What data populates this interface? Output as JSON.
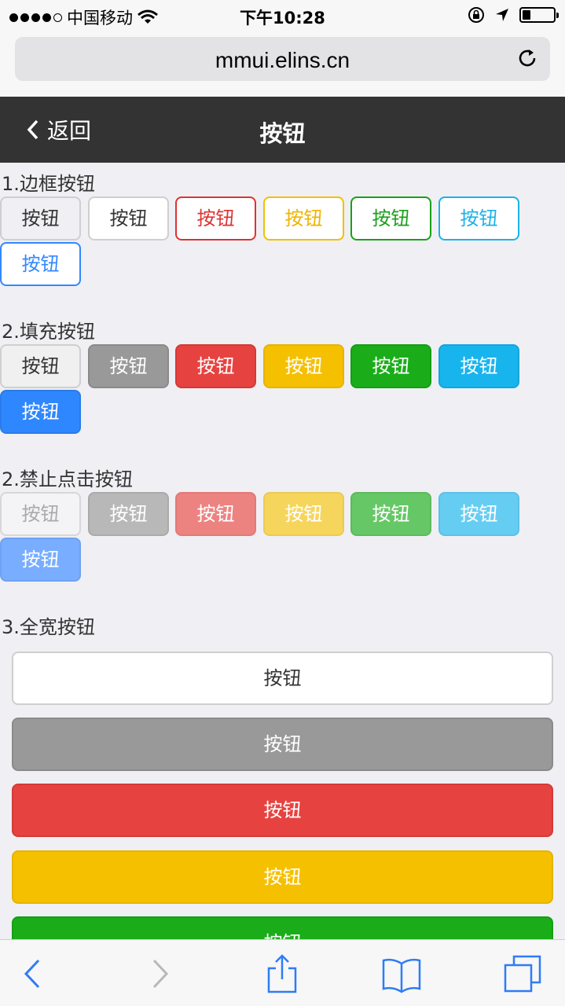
{
  "status": {
    "carrier": "中国移动",
    "time": "下午10:28",
    "battery_level": 0.25
  },
  "browser": {
    "url": "mmui.elins.cn",
    "reload_icon": "reload-icon"
  },
  "nav": {
    "back_label": "返回",
    "title": "按钮"
  },
  "sections": {
    "outline": {
      "title": "1.边框按钮"
    },
    "filled": {
      "title": "2.填充按钮"
    },
    "disabled": {
      "title": "2.禁止点击按钮"
    },
    "fullwidth": {
      "title": "3.全宽按钮"
    }
  },
  "button_label": "按钮",
  "colors": {
    "red": "#e64340",
    "yellow": "#f5c000",
    "green": "#1aad19",
    "cyan": "#18b4ed",
    "blue": "#2e87ff",
    "gray": "#999999",
    "header": "#333333"
  },
  "toolbar": {
    "icons": [
      "back-arrow-icon",
      "forward-arrow-icon",
      "share-icon",
      "bookmarks-icon",
      "tabs-icon"
    ]
  }
}
